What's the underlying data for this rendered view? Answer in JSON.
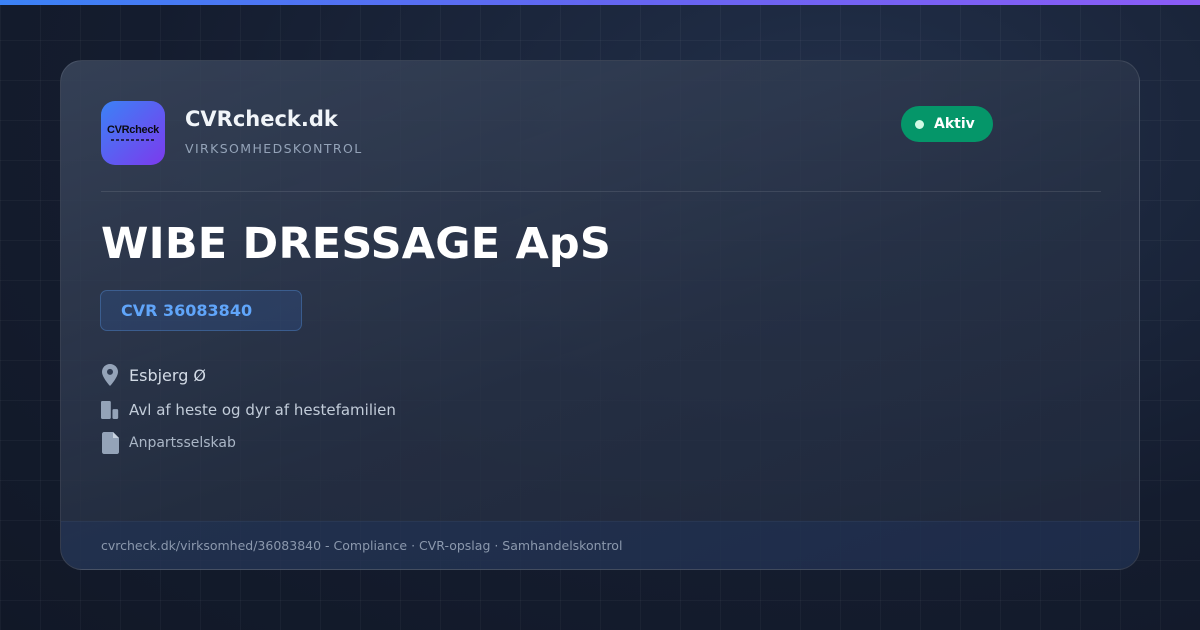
{
  "brand": {
    "logo_text": "CVRcheck",
    "name": "CVRcheck.dk",
    "tagline": "VIRKSOMHEDSKONTROL"
  },
  "status": {
    "label": "Aktiv",
    "color": "#059669"
  },
  "company": {
    "name": "WIBE DRESSAGE ApS",
    "cvr": "CVR 36083840",
    "location": "Esbjerg Ø",
    "industry": "Avl af heste og dyr af hestefamilien",
    "type": "Anpartsselskab"
  },
  "icons": {
    "location": "map-pin-icon",
    "industry": "building-icon",
    "type": "document-icon"
  },
  "footer": {
    "text": "cvrcheck.dk/virksomhed/36083840 - Compliance · CVR-opslag · Samhandelskontrol"
  },
  "colors": {
    "accent_gradient_start": "#3b82f6",
    "accent_gradient_end": "#8b5cf6",
    "cvr_text": "#60a5fa",
    "background": "#141c2e"
  }
}
